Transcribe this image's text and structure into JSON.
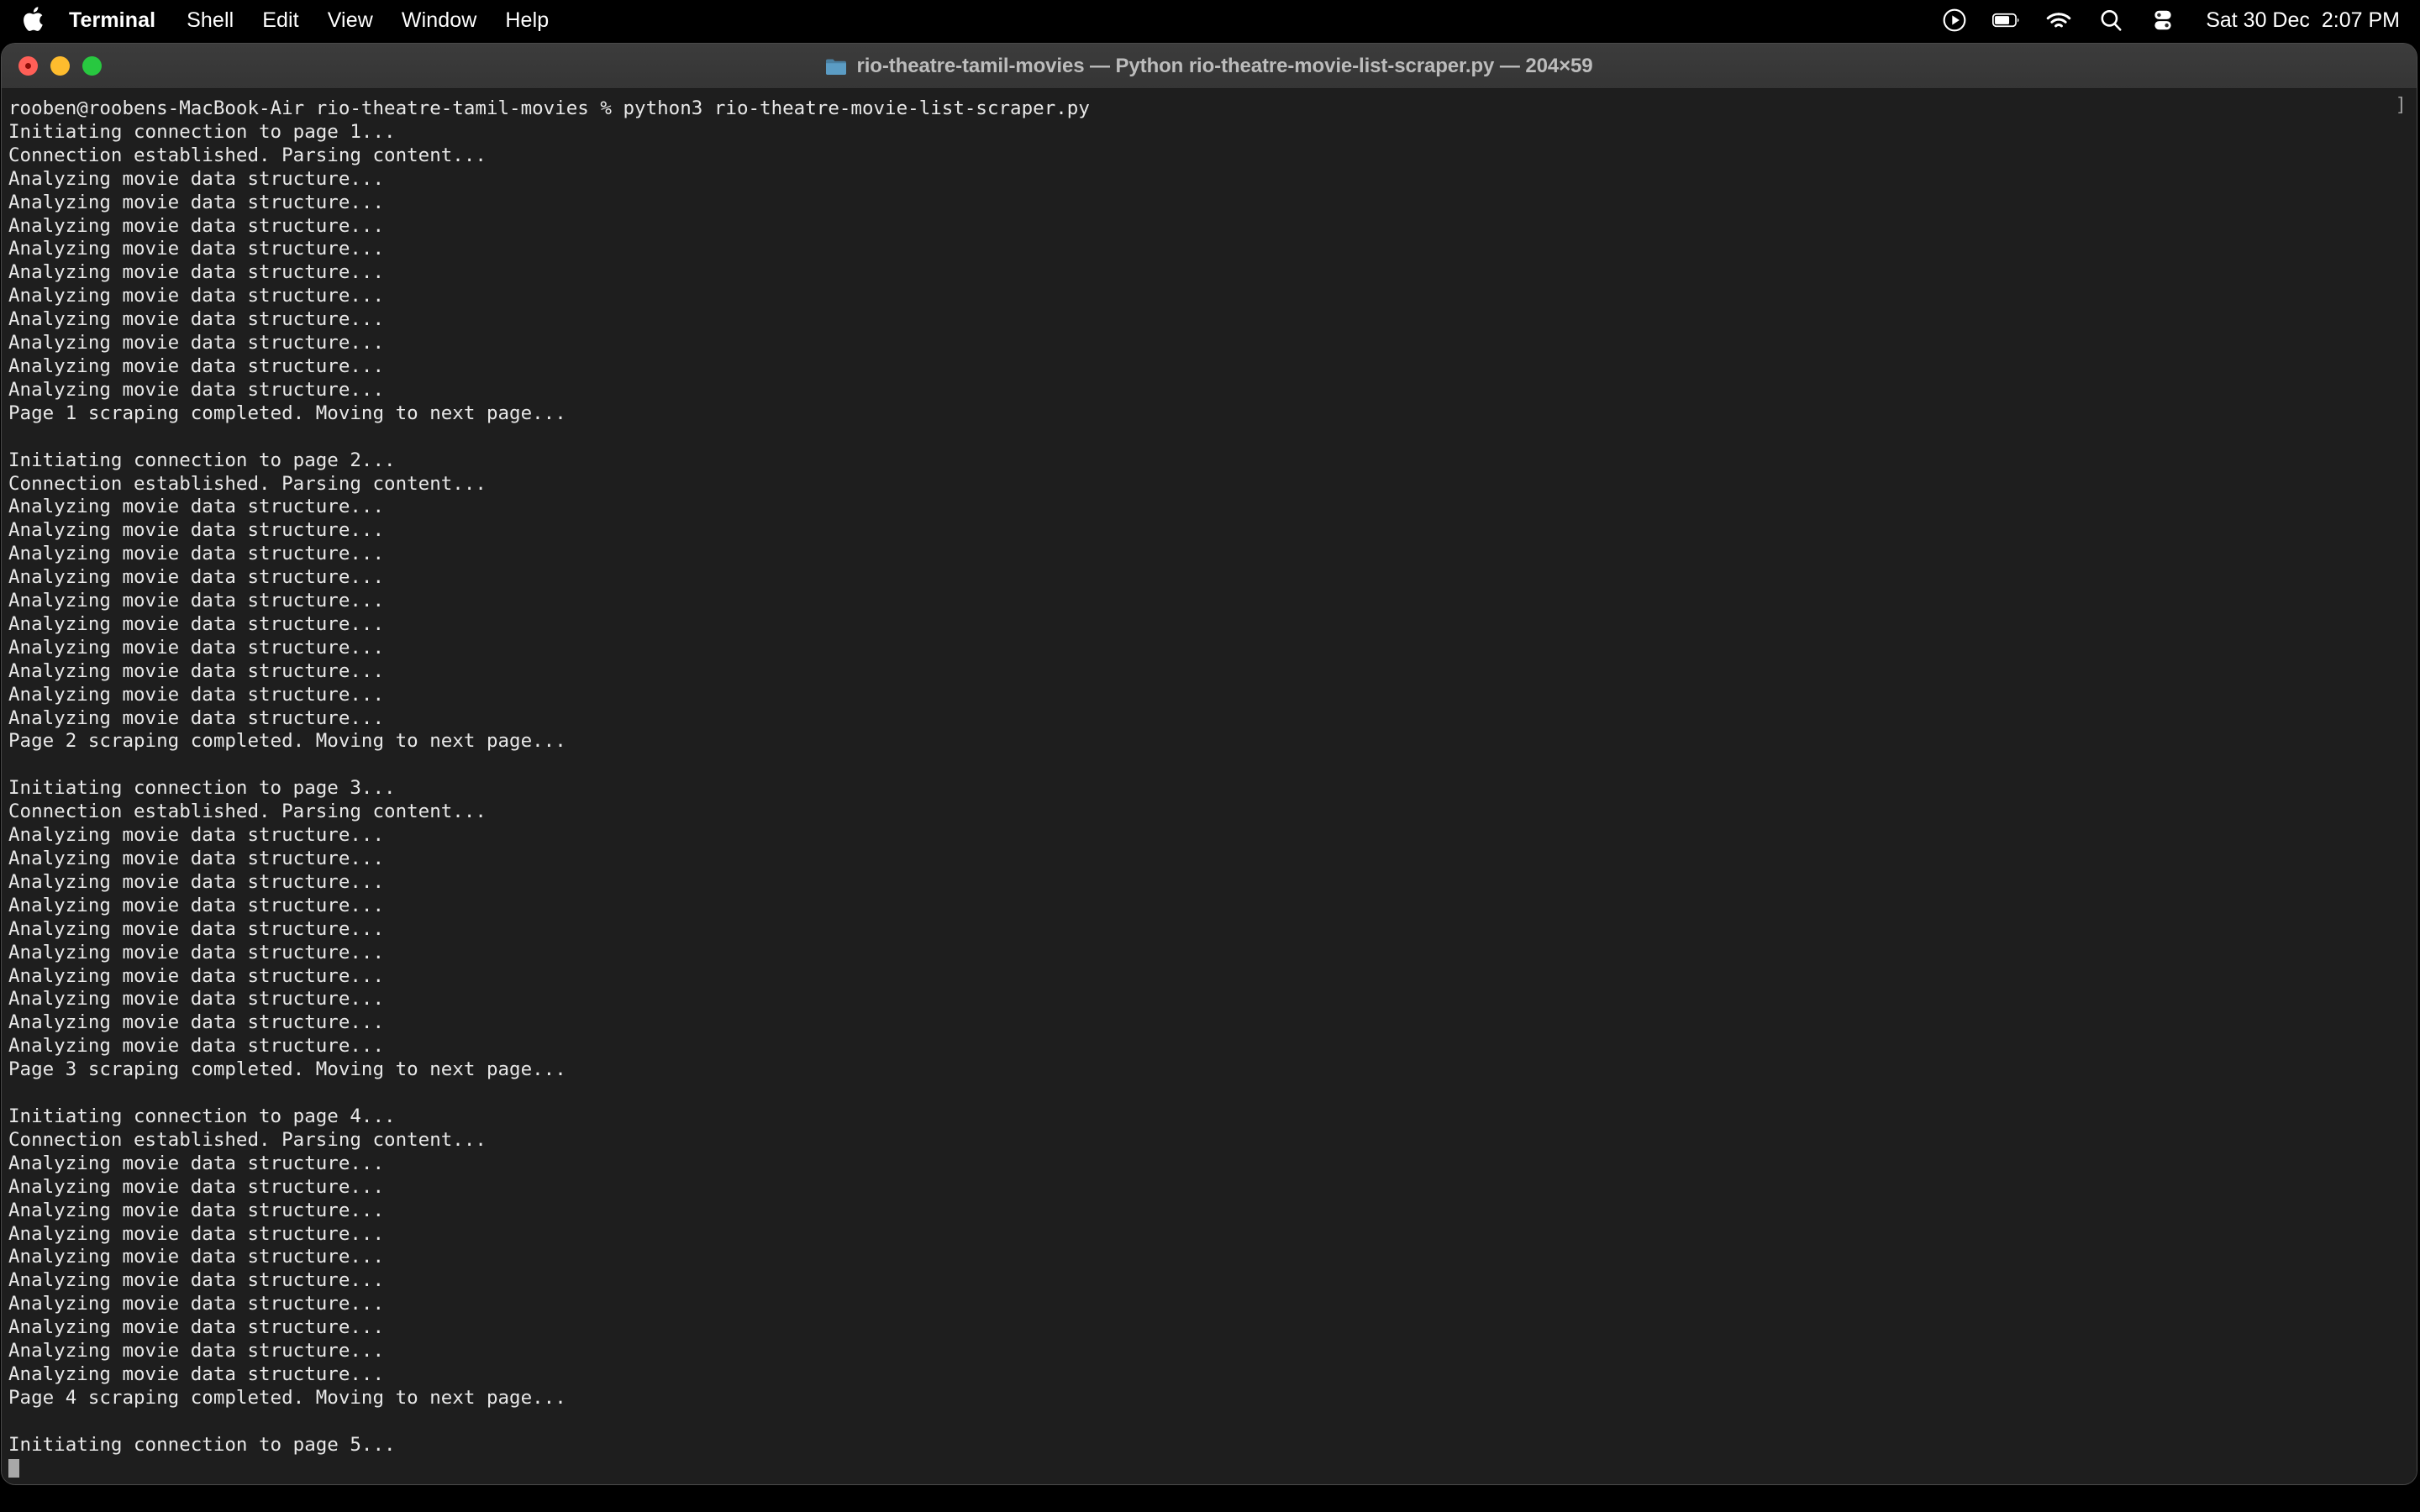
{
  "menubar": {
    "apple_icon": "apple-logo-icon",
    "items": [
      {
        "label": "Terminal",
        "bold": true
      },
      {
        "label": "Shell",
        "bold": false
      },
      {
        "label": "Edit",
        "bold": false
      },
      {
        "label": "View",
        "bold": false
      },
      {
        "label": "Window",
        "bold": false
      },
      {
        "label": "Help",
        "bold": false
      }
    ],
    "status_icons": [
      "screen-recording-icon",
      "battery-icon",
      "wifi-icon",
      "search-icon",
      "control-center-icon"
    ],
    "date": "Sat 30 Dec",
    "time": "2:07 PM",
    "background_color": "#000000",
    "text_color": "#ffffff"
  },
  "window": {
    "title": "rio-theatre-tamil-movies — Python rio-theatre-movie-list-scraper.py — 204×59",
    "folder_icon": "folder-icon",
    "traffic_lights": {
      "close_label": "Close",
      "minimize_label": "Minimize",
      "maximize_label": "Zoom",
      "close_color": "#ff5f57",
      "minimize_color": "#febc2e",
      "maximize_color": "#28c840"
    },
    "titlebar_color": "#3a3a3a",
    "background_color": "#1e1e1e",
    "text_color": "#e8e8e8",
    "columns": 204,
    "rows": 59
  },
  "terminal": {
    "prompt_user": "rooben",
    "prompt_host": "roobens-MacBook-Air",
    "prompt_dir": "rio-theatre-tamil-movies",
    "prompt_symbol": "%",
    "command": "python3 rio-theatre-movie-list-scraper.py",
    "prompt_line": "rooben@roobens-MacBook-Air rio-theatre-tamil-movies % python3 rio-theatre-movie-list-scraper.py",
    "right_edge_marker": "]",
    "analyzing_line": "Analyzing movie data structure...",
    "connection_line": "Connection established. Parsing content...",
    "analyzing_count_per_page": 10,
    "output": [
      "rooben@roobens-MacBook-Air rio-theatre-tamil-movies % python3 rio-theatre-movie-list-scraper.py",
      "Initiating connection to page 1...",
      "Connection established. Parsing content...",
      "Analyzing movie data structure...",
      "Analyzing movie data structure...",
      "Analyzing movie data structure...",
      "Analyzing movie data structure...",
      "Analyzing movie data structure...",
      "Analyzing movie data structure...",
      "Analyzing movie data structure...",
      "Analyzing movie data structure...",
      "Analyzing movie data structure...",
      "Analyzing movie data structure...",
      "Page 1 scraping completed. Moving to next page...",
      "",
      "Initiating connection to page 2...",
      "Connection established. Parsing content...",
      "Analyzing movie data structure...",
      "Analyzing movie data structure...",
      "Analyzing movie data structure...",
      "Analyzing movie data structure...",
      "Analyzing movie data structure...",
      "Analyzing movie data structure...",
      "Analyzing movie data structure...",
      "Analyzing movie data structure...",
      "Analyzing movie data structure...",
      "Analyzing movie data structure...",
      "Page 2 scraping completed. Moving to next page...",
      "",
      "Initiating connection to page 3...",
      "Connection established. Parsing content...",
      "Analyzing movie data structure...",
      "Analyzing movie data structure...",
      "Analyzing movie data structure...",
      "Analyzing movie data structure...",
      "Analyzing movie data structure...",
      "Analyzing movie data structure...",
      "Analyzing movie data structure...",
      "Analyzing movie data structure...",
      "Analyzing movie data structure...",
      "Analyzing movie data structure...",
      "Page 3 scraping completed. Moving to next page...",
      "",
      "Initiating connection to page 4...",
      "Connection established. Parsing content...",
      "Analyzing movie data structure...",
      "Analyzing movie data structure...",
      "Analyzing movie data structure...",
      "Analyzing movie data structure...",
      "Analyzing movie data structure...",
      "Analyzing movie data structure...",
      "Analyzing movie data structure...",
      "Analyzing movie data structure...",
      "Analyzing movie data structure...",
      "Analyzing movie data structure...",
      "Page 4 scraping completed. Moving to next page...",
      "",
      "Initiating connection to page 5..."
    ],
    "cursor": "block"
  }
}
